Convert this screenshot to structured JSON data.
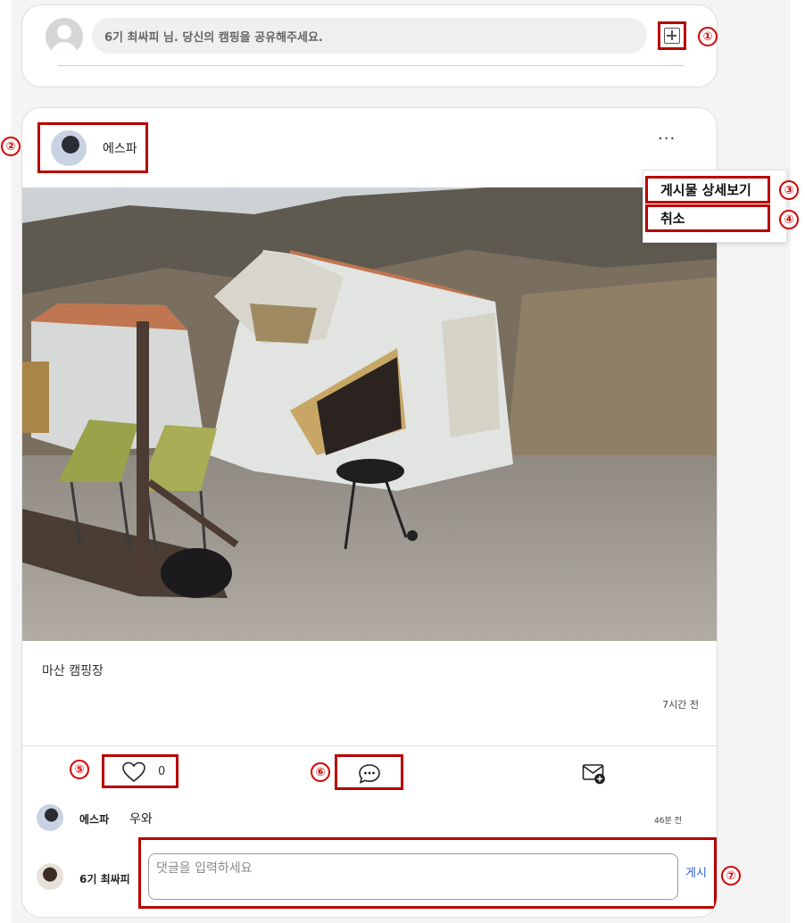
{
  "composer": {
    "placeholder": "6기 최싸피 님. 당신의 캠핑을 공유해주세요."
  },
  "post": {
    "author": "에스파",
    "caption": "마산 캠핑장",
    "time": "7시간 전",
    "likes": "0",
    "menu": {
      "detail": "게시물 상세보기",
      "cancel": "취소"
    },
    "comments": [
      {
        "author": "에스파",
        "text": "우와",
        "time": "46분 전"
      }
    ],
    "comment_form": {
      "current_user": "6기 최싸피",
      "placeholder": "댓글을 입력하세요",
      "submit_label": "게시"
    }
  },
  "markers": [
    "①",
    "②",
    "③",
    "④",
    "⑤",
    "⑥",
    "⑦"
  ],
  "colors": {
    "annotation": "#b80000",
    "link": "#2f5fd6"
  },
  "icons": [
    "user-icon",
    "plus-square-icon",
    "more-icon",
    "heart-icon",
    "comment-icon",
    "mail-plus-icon"
  ]
}
